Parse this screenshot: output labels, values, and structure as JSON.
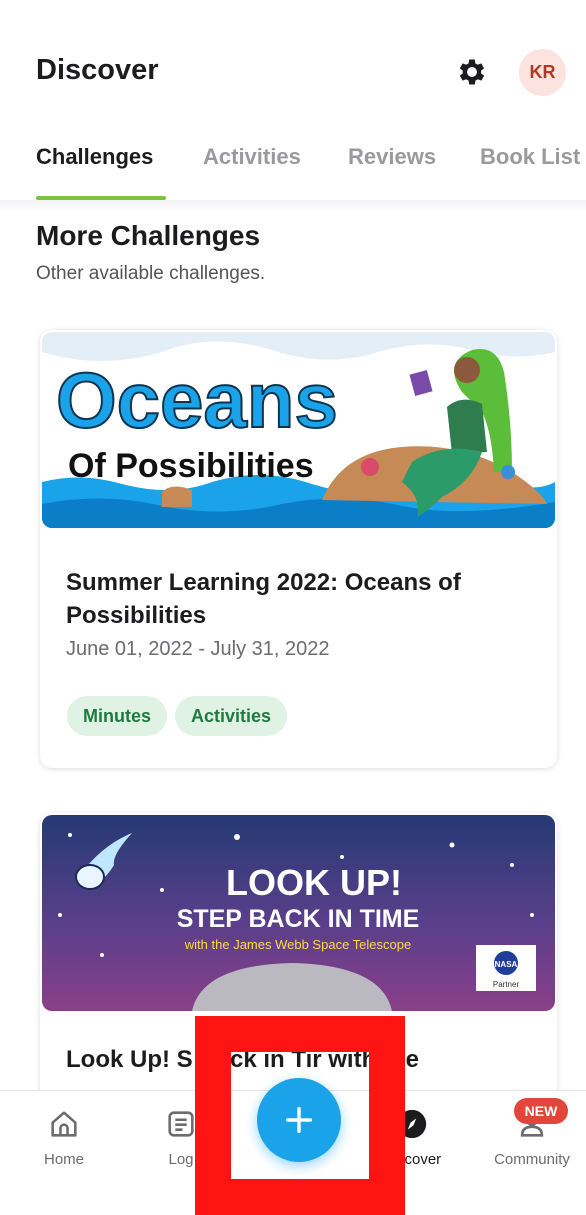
{
  "header": {
    "title": "Discover",
    "settings_icon": "gear-icon",
    "avatar_initials": "KR"
  },
  "tabs": [
    {
      "label": "Challenges",
      "active": true
    },
    {
      "label": "Activities",
      "active": false
    },
    {
      "label": "Reviews",
      "active": false
    },
    {
      "label": "Book List",
      "active": false
    }
  ],
  "section": {
    "title": "More Challenges",
    "subtitle": "Other available challenges."
  },
  "challenges": [
    {
      "banner": {
        "title_line1": "Oceans",
        "title_line2": "Of Possibilities"
      },
      "title": "Summer Learning 2022: Oceans of Possibilities",
      "dates": "June 01, 2022 - July 31, 2022",
      "tags": [
        "Minutes",
        "Activities"
      ]
    },
    {
      "banner": {
        "line1": "LOOK UP!",
        "line2": "STEP BACK IN TIME",
        "line3": "with the James Webb Space Telescope",
        "badge_logo": "NASA",
        "badge_label": "Partner"
      },
      "title": "Look Up! S  Back in Tir  with the"
    }
  ],
  "bottom_nav": {
    "items": [
      {
        "label": "Home",
        "icon": "home-icon",
        "active": false
      },
      {
        "label": "Log",
        "icon": "log-icon",
        "active": false
      },
      {
        "label": "Discover",
        "icon": "discover-icon",
        "active": true
      },
      {
        "label": "Community",
        "icon": "community-icon",
        "active": false
      }
    ],
    "community_badge": "NEW",
    "add_icon": "plus-icon"
  },
  "colors": {
    "accent_tab": "#7cc142",
    "fab": "#1aa3e8",
    "tag_bg": "#dff2e4",
    "tag_text": "#1e7a3e",
    "badge": "#e2463a",
    "redaction": "#ff1414"
  }
}
